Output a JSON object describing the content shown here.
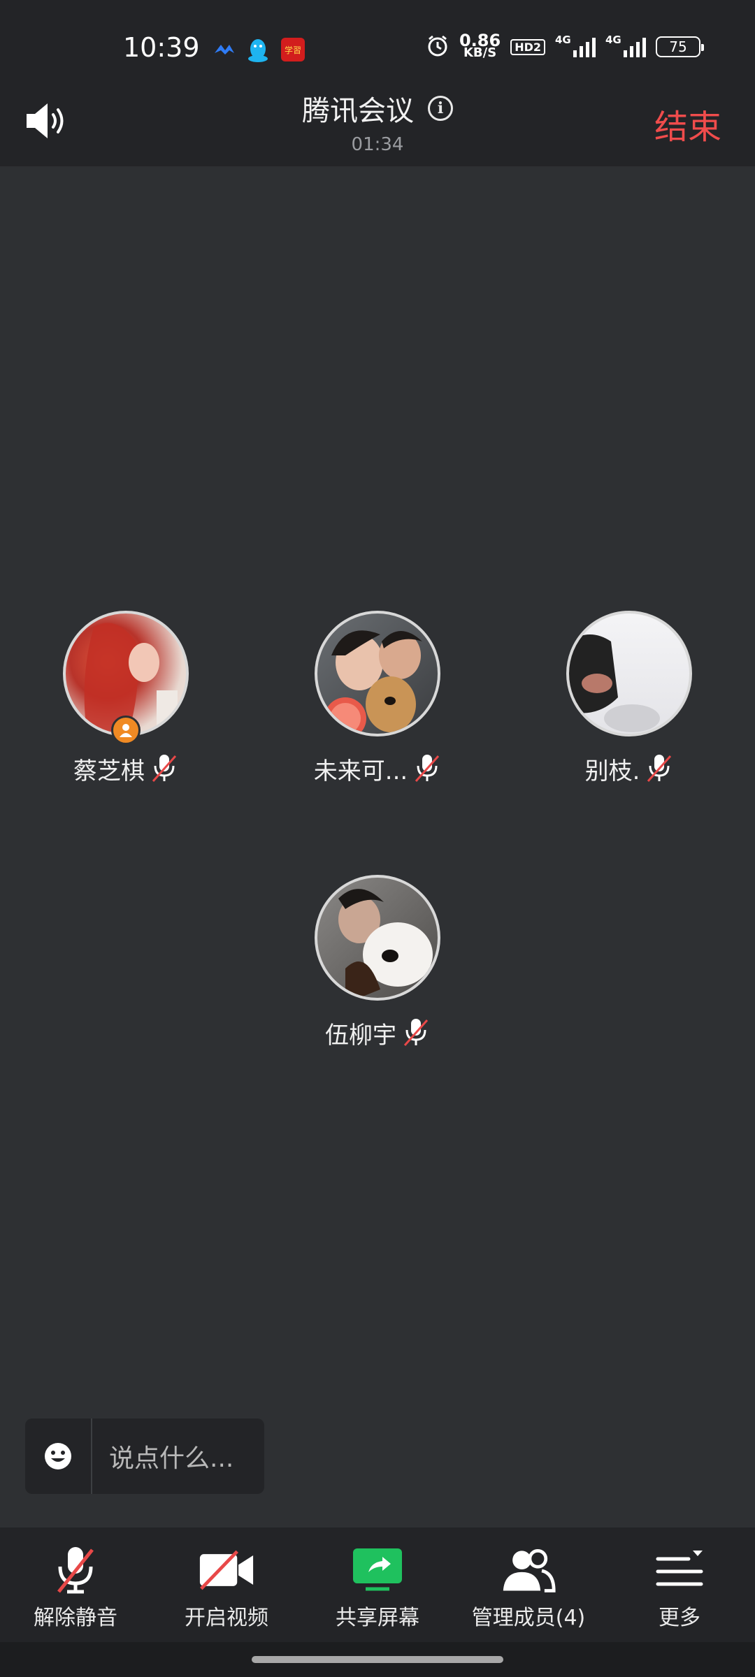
{
  "status_bar": {
    "time": "10:39",
    "app_icons": [
      "feishu-icon",
      "qq-icon",
      "xuexi-icon"
    ],
    "xuexi_text": "学習",
    "net_speed_value": "0.86",
    "net_speed_unit": "KB/S",
    "hd_label": "HD2",
    "signal1_label": "4G",
    "signal2_label": "4G",
    "battery": "75"
  },
  "header": {
    "title": "腾讯会议",
    "timer": "01:34",
    "end_label": "结束"
  },
  "participants": [
    {
      "name": "蔡芝棋",
      "is_host": true,
      "muted": true
    },
    {
      "name": "未来可...",
      "is_host": false,
      "muted": true
    },
    {
      "name": "别枝.",
      "is_host": false,
      "muted": true
    },
    {
      "name": "伍柳宇",
      "is_host": false,
      "muted": true
    }
  ],
  "chat": {
    "placeholder": "说点什么..."
  },
  "toolbar": {
    "unmute_label": "解除静音",
    "video_label": "开启视频",
    "share_label": "共享屏幕",
    "members_label": "管理成员(4)",
    "more_label": "更多"
  },
  "colors": {
    "background": "#2e3033",
    "bar": "#232427",
    "end_red": "#f04c4c",
    "share_green": "#1fc15e",
    "host_orange": "#f08a24",
    "mute_slash": "#e84848"
  }
}
